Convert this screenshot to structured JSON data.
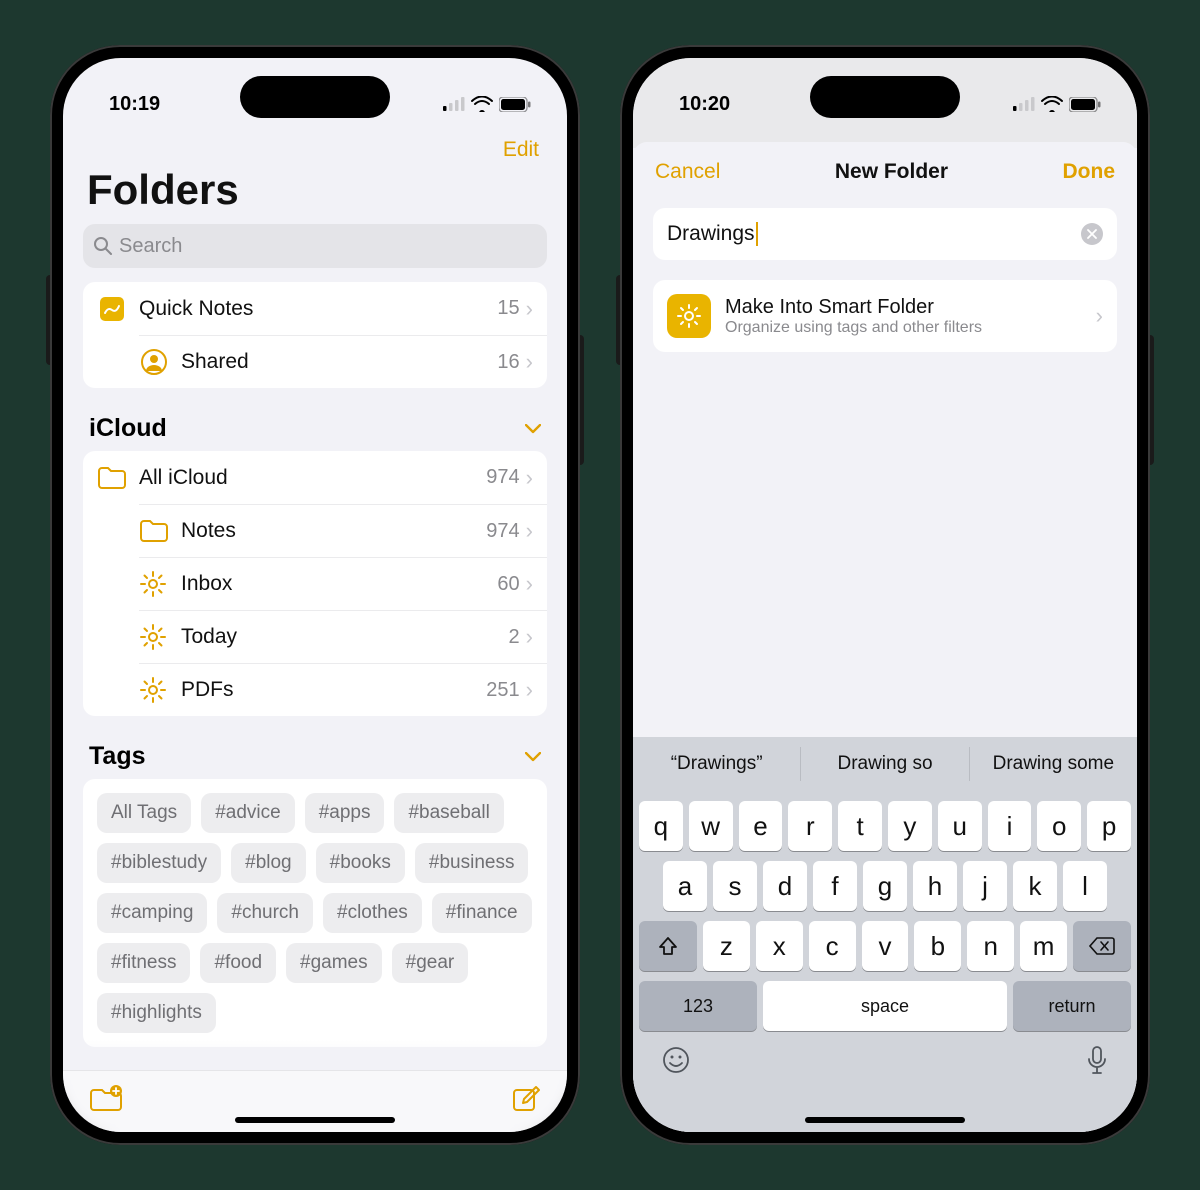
{
  "phone1": {
    "status_time": "10:19",
    "edit_label": "Edit",
    "title": "Folders",
    "search_placeholder": "Search",
    "top_rows": [
      {
        "label": "Quick Notes",
        "count": "15",
        "icon": "quicknote"
      },
      {
        "label": "Shared",
        "count": "16",
        "icon": "shared"
      }
    ],
    "icloud_header": "iCloud",
    "icloud_rows": [
      {
        "label": "All iCloud",
        "count": "974",
        "icon": "folder"
      },
      {
        "label": "Notes",
        "count": "974",
        "icon": "folder"
      },
      {
        "label": "Inbox",
        "count": "60",
        "icon": "gear"
      },
      {
        "label": "Today",
        "count": "2",
        "icon": "gear"
      },
      {
        "label": "PDFs",
        "count": "251",
        "icon": "gear"
      }
    ],
    "tags_header": "Tags",
    "tags": [
      "All Tags",
      "#advice",
      "#apps",
      "#baseball",
      "#biblestudy",
      "#blog",
      "#books",
      "#business",
      "#camping",
      "#church",
      "#clothes",
      "#finance",
      "#fitness",
      "#food",
      "#games",
      "#gear",
      "#highlights"
    ]
  },
  "phone2": {
    "status_time": "10:20",
    "cancel": "Cancel",
    "title": "New Folder",
    "done": "Done",
    "input_value": "Drawings",
    "smart_title": "Make Into Smart Folder",
    "smart_sub": "Organize using tags and other filters",
    "suggestions": [
      "“Drawings”",
      "Drawing so",
      "Drawing some"
    ],
    "keys_row1": [
      "q",
      "w",
      "e",
      "r",
      "t",
      "y",
      "u",
      "i",
      "o",
      "p"
    ],
    "keys_row2": [
      "a",
      "s",
      "d",
      "f",
      "g",
      "h",
      "j",
      "k",
      "l"
    ],
    "keys_row3": [
      "z",
      "x",
      "c",
      "v",
      "b",
      "n",
      "m"
    ],
    "key_123": "123",
    "key_space": "space",
    "key_return": "return"
  }
}
